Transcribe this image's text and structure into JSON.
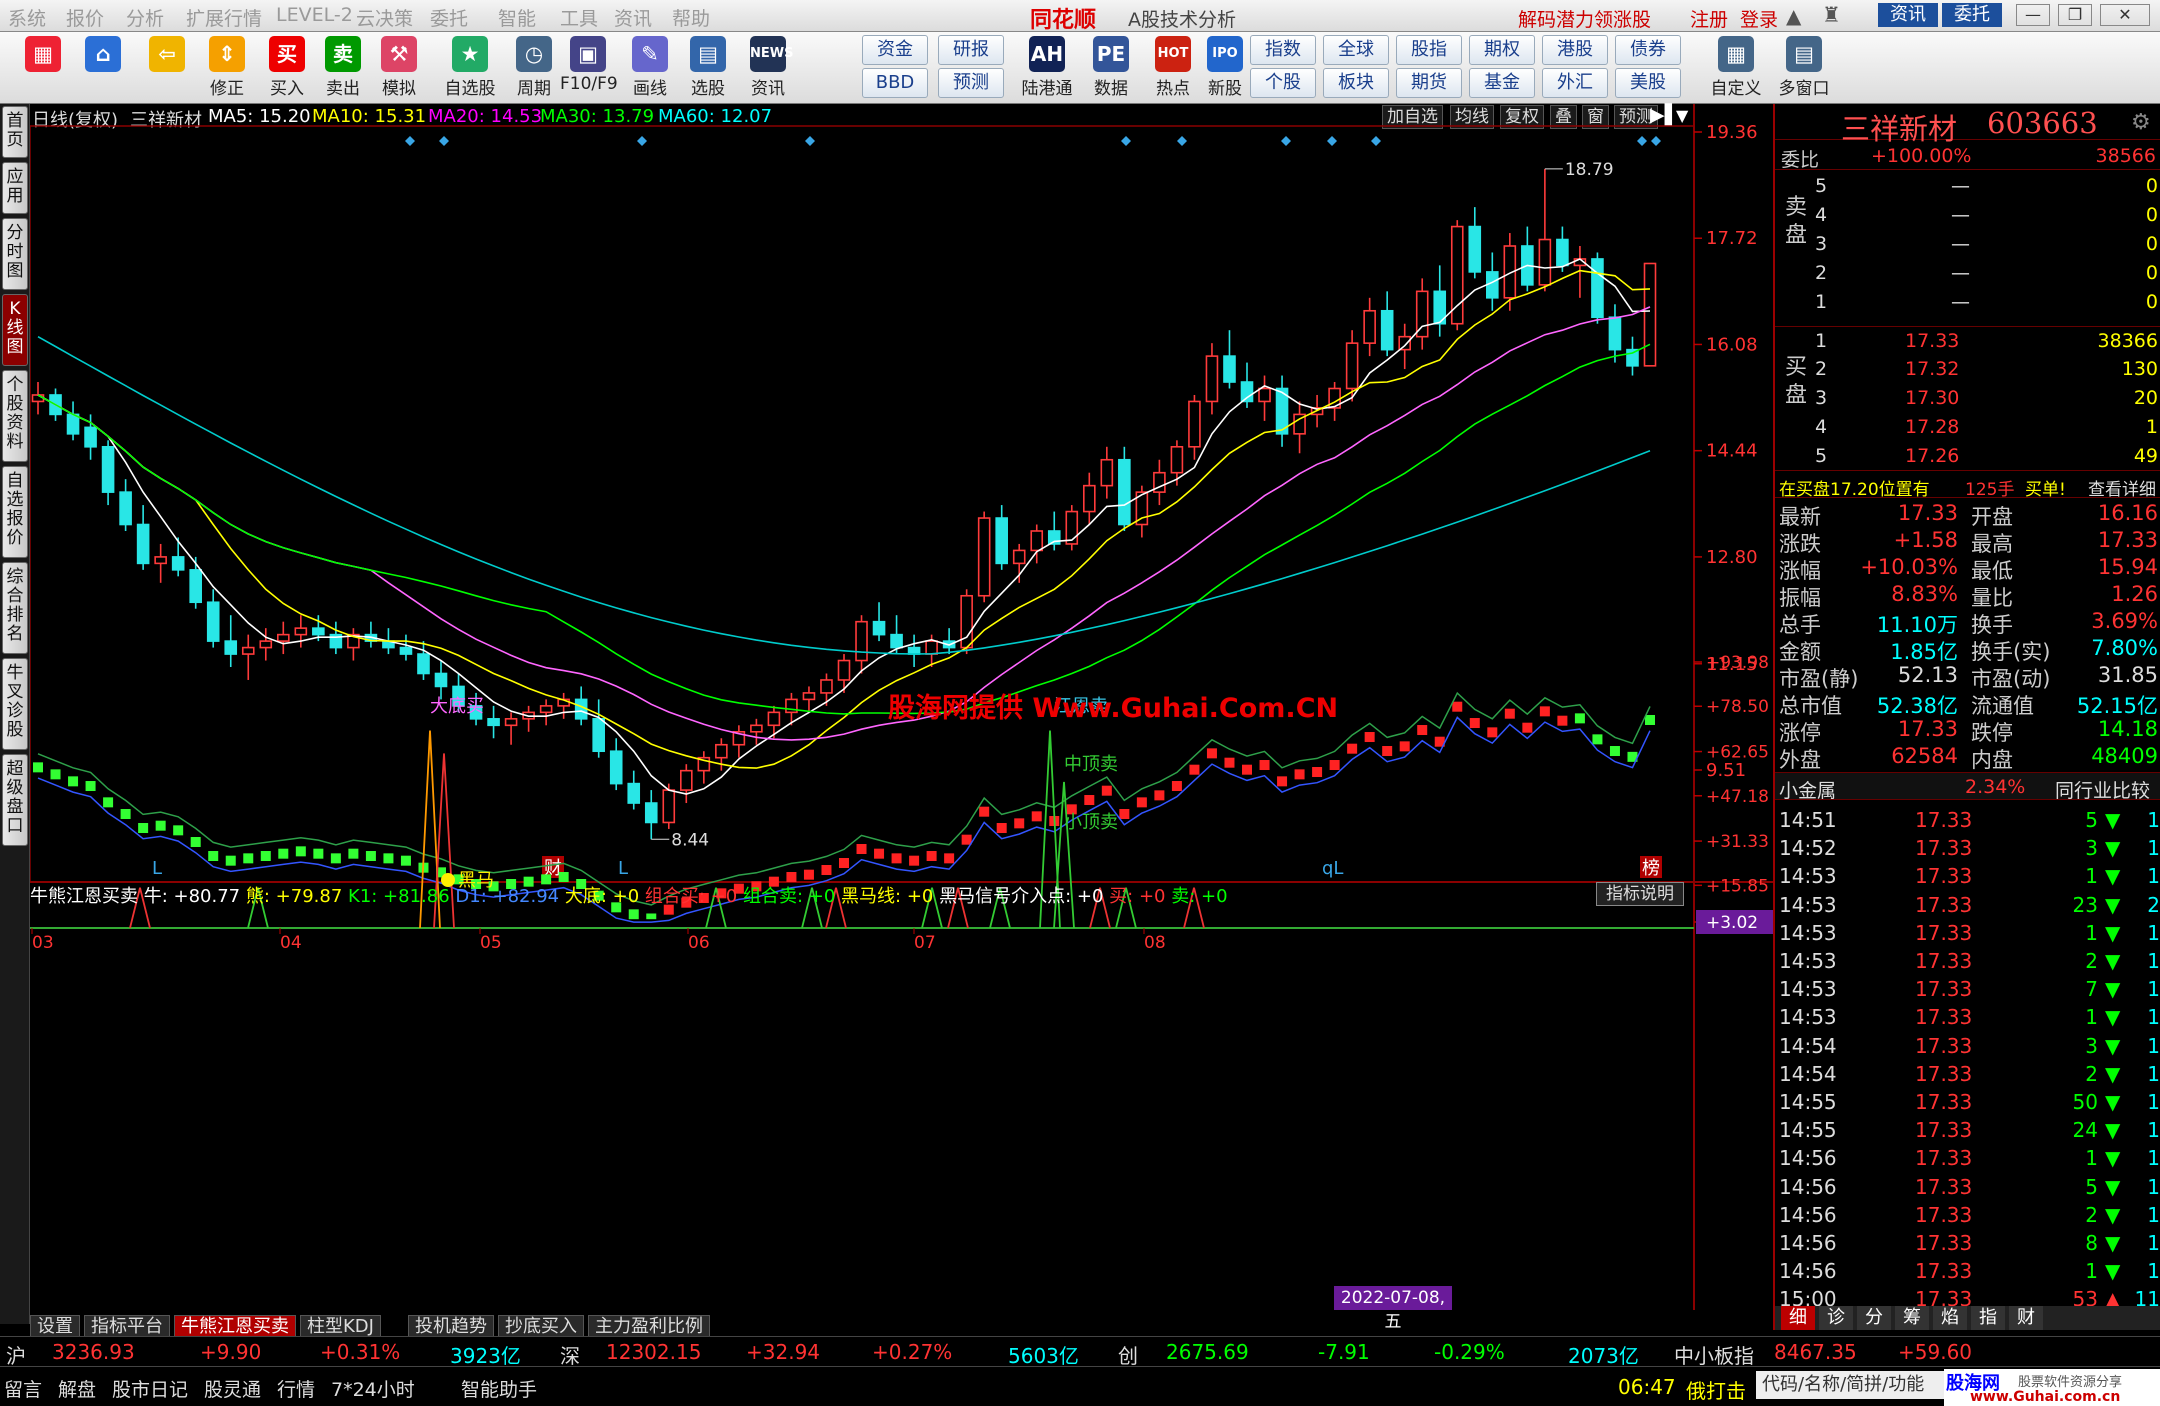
{
  "menu": [
    "系统",
    "报价",
    "分析",
    "扩展行情",
    "LEVEL-2",
    "云决策",
    "委托",
    "智能",
    "工具",
    "资讯",
    "帮助"
  ],
  "app_logo": "同花顺",
  "app_title": "A股技术分析",
  "menu_right": {
    "promo": "解码潜力领涨股",
    "register": "注册",
    "login": "登录",
    "news": "资讯",
    "trade": "委托"
  },
  "toolbar": [
    {
      "label": "",
      "icon": "grid-icon",
      "color": "#e23"
    },
    {
      "label": "",
      "icon": "home-icon",
      "color": "#2b6fd6"
    },
    {
      "label": "",
      "icon": "back-arrow-icon",
      "color": "#f0b400"
    },
    {
      "label": "修正",
      "icon": "updown-icon",
      "color": "#f5a000"
    },
    {
      "label": "买入",
      "icon": "buy-icon",
      "color": "#e00",
      "ch": "买"
    },
    {
      "label": "卖出",
      "icon": "sell-icon",
      "color": "#090",
      "ch": "卖"
    },
    {
      "label": "模拟",
      "icon": "hammer-icon",
      "color": "#d46"
    },
    {
      "label": "自选股",
      "icon": "star-icon",
      "color": "#2a6"
    },
    {
      "label": "周期",
      "icon": "clock-icon",
      "color": "#468"
    },
    {
      "label": "F10/F9",
      "icon": "f10-icon",
      "color": "#448"
    },
    {
      "label": "画线",
      "icon": "pen-icon",
      "color": "#66c"
    },
    {
      "label": "选股",
      "icon": "select-icon",
      "color": "#36a"
    },
    {
      "label": "资讯",
      "icon": "news-icon",
      "color": "#235",
      "ch": "NEWS"
    }
  ],
  "toolbar_blocks": [
    {
      "top": "资金",
      "bottom": "BBD"
    },
    {
      "top": "研报",
      "bottom": "预测"
    }
  ],
  "toolbar2": [
    {
      "label": "陆港通",
      "ch": "AH",
      "color": "#125"
    },
    {
      "label": "数据",
      "ch": "PE",
      "color": "#359"
    },
    {
      "label": "热点",
      "ch": "HOT",
      "color": "#c21"
    },
    {
      "label": "新股",
      "ch": "IPO",
      "color": "#26c"
    }
  ],
  "toolbar_grid": [
    [
      "指数",
      "全球",
      "股指",
      "期权",
      "港股",
      "债券"
    ],
    [
      "个股",
      "板块",
      "期货",
      "基金",
      "外汇",
      "美股"
    ]
  ],
  "toolbar_end": [
    {
      "label": "自定义"
    },
    {
      "label": "多窗口"
    }
  ],
  "left_tabs": [
    "首页",
    "应用",
    "分时图",
    "K线图",
    "个股资料",
    "自选报价",
    "综合排名",
    "牛叉诊股",
    "超级盘口"
  ],
  "main_header": {
    "period": "日线(复权)",
    "name": "三祥新材",
    "ma5": "MA5: 15.20",
    "ma10": "MA10: 15.31",
    "ma20": "MA20: 14.53",
    "ma30": "MA30: 13.79",
    "ma60": "MA60: 12.07"
  },
  "main_tools": [
    "加自选",
    "均线",
    "复权",
    "叠",
    "窗",
    "预测"
  ],
  "watermark": "股海网提供 Www.Guhai.Com.CN",
  "price_axis": [
    "19.36",
    "17.72",
    "16.08",
    "14.44",
    "12.80",
    "11.15",
    "9.51"
  ],
  "price_high_label": "18.79",
  "price_low_label": "8.44",
  "main_bottom_marks": [
    "L",
    "财",
    "L",
    "qL",
    "榜"
  ],
  "ind_header": {
    "name": "牛熊江恩买卖",
    "niu": "牛: +80.77",
    "xiong": "熊: +79.87",
    "k1": "K1: +81.86",
    "d1": "D1: +82.94",
    "dadi": "大底: +0",
    "zhmai": "组合买: +0",
    "zhmaichu": "组合卖: +0",
    "heima": "黑马线: +0",
    "heima2": "黑马信号介入点: +0",
    "mai": "买: +0",
    "maichu": "卖: +0",
    "explain": "指标说明"
  },
  "ind_axis": [
    "+93.98",
    "+78.50",
    "+62.65",
    "+47.18",
    "+31.33",
    "+15.85",
    "+3.02"
  ],
  "ind_labels": {
    "dadi": "大底买",
    "heima": "黑马",
    "jiangen": "江恩卖",
    "zhong": "中顶卖",
    "xiao": "小顶卖"
  },
  "x_axis": [
    "03",
    "04",
    "05",
    "06",
    "07",
    "08"
  ],
  "date_badge": "2022-07-08,五",
  "bottom_tabs": [
    "设置",
    "指标平台",
    "牛熊江恩买卖",
    "柱型KDJ",
    "投机趋势",
    "抄底买入",
    "主力盈利比例"
  ],
  "stock": {
    "name": "三祥新材",
    "code": "603663"
  },
  "weibi": {
    "label": "委比",
    "pct": "+100.00%",
    "val": "38566"
  },
  "sell": [
    {
      "n": "5",
      "p": "—",
      "v": "0"
    },
    {
      "n": "4",
      "p": "—",
      "v": "0"
    },
    {
      "n": "3",
      "p": "—",
      "v": "0"
    },
    {
      "n": "2",
      "p": "—",
      "v": "0"
    },
    {
      "n": "1",
      "p": "—",
      "v": "0"
    }
  ],
  "buy": [
    {
      "n": "1",
      "p": "17.33",
      "v": "38366"
    },
    {
      "n": "2",
      "p": "17.32",
      "v": "130"
    },
    {
      "n": "3",
      "p": "17.30",
      "v": "20"
    },
    {
      "n": "4",
      "p": "17.28",
      "v": "1"
    },
    {
      "n": "5",
      "p": "17.26",
      "v": "49"
    }
  ],
  "sell_label": "卖盘",
  "buy_label": "买盘",
  "notice": {
    "t1": "在买盘17.20位置有",
    "t2": "125手",
    "t3": "买单!",
    "t4": "查看详细"
  },
  "quote": [
    [
      "最新",
      "17.33",
      "开盘",
      "16.16"
    ],
    [
      "涨跌",
      "+1.58",
      "最高",
      "17.33"
    ],
    [
      "涨幅",
      "+10.03%",
      "最低",
      "15.94"
    ],
    [
      "振幅",
      "8.83%",
      "量比",
      "1.26"
    ],
    [
      "总手",
      "11.10万",
      "换手",
      "3.69%"
    ],
    [
      "金额",
      "1.85亿",
      "换手(实)",
      "7.80%"
    ],
    [
      "市盈(静)",
      "52.13",
      "市盈(动)",
      "31.85"
    ],
    [
      "总市值",
      "52.38亿",
      "流通值",
      "52.15亿"
    ],
    [
      "涨停",
      "17.33",
      "跌停",
      "14.18"
    ],
    [
      "外盘",
      "62584",
      "内盘",
      "48409"
    ]
  ],
  "sector": {
    "name": "小金属",
    "pct": "2.34%",
    "btn": "同行业比较"
  },
  "ticks": [
    [
      "14:51",
      "17.33",
      "5"
    ],
    [
      "14:52",
      "17.33",
      "3"
    ],
    [
      "14:53",
      "17.33",
      "1"
    ],
    [
      "14:53",
      "17.33",
      "23"
    ],
    [
      "14:53",
      "17.33",
      "1"
    ],
    [
      "14:53",
      "17.33",
      "2"
    ],
    [
      "14:53",
      "17.33",
      "7"
    ],
    [
      "14:53",
      "17.33",
      "1"
    ],
    [
      "14:54",
      "17.33",
      "3"
    ],
    [
      "14:54",
      "17.33",
      "2"
    ],
    [
      "14:55",
      "17.33",
      "50"
    ],
    [
      "14:55",
      "17.33",
      "24"
    ],
    [
      "14:56",
      "17.33",
      "1"
    ],
    [
      "14:56",
      "17.33",
      "5"
    ],
    [
      "14:56",
      "17.33",
      "2"
    ],
    [
      "14:56",
      "17.33",
      "8"
    ],
    [
      "14:56",
      "17.33",
      "1"
    ],
    [
      "15:00",
      "17.33",
      "53"
    ]
  ],
  "tick_extra": [
    "1",
    "1",
    "1",
    "2",
    "1",
    "1",
    "1",
    "1",
    "1",
    "1",
    "1",
    "1",
    "1",
    "1",
    "1",
    "1",
    "1",
    "11"
  ],
  "rp_tabs": [
    "细",
    "诊",
    "分",
    "筹",
    "焰",
    "指",
    "财"
  ],
  "index_bar": {
    "sh": "沪",
    "sh_val": "3236.93",
    "sh_chg": "+9.90",
    "sh_pct": "+0.31%",
    "sh_amt": "3923亿",
    "sz": "深",
    "sz_val": "12302.15",
    "sz_chg": "+32.94",
    "sz_pct": "+0.27%",
    "sz_amt": "5603亿",
    "cy": "创",
    "cy_val": "2675.69",
    "cy_chg": "-7.91",
    "cy_pct": "-0.29%",
    "cy_amt": "2073亿",
    "zx": "中小板指",
    "zx_val": "8467.35",
    "zx_chg": "+59.60"
  },
  "status_bar": [
    "留言",
    "解盘",
    "股市日记",
    "股灵通",
    "行情",
    "7*24小时",
    "智能助手"
  ],
  "status_time": "06:47",
  "status_msg": "俄打击",
  "search": "代码/名称/简拼/功能",
  "site": "股海网",
  "site_sub": "股票软件资源分享",
  "site_url": "www.Guhai.com.cn",
  "chart_data": {
    "type": "candlestick",
    "ylim": [
      8.44,
      19.36
    ],
    "x": [
      "03",
      "04",
      "05",
      "06",
      "07",
      "08"
    ],
    "high": 18.79,
    "low": 8.44,
    "ohlc": [
      [
        15.2,
        15.5,
        15.0,
        15.3
      ],
      [
        15.3,
        15.4,
        14.9,
        15.0
      ],
      [
        15.0,
        15.2,
        14.6,
        14.7
      ],
      [
        14.8,
        15.0,
        14.3,
        14.5
      ],
      [
        14.5,
        14.6,
        13.6,
        13.8
      ],
      [
        13.8,
        14.0,
        13.2,
        13.3
      ],
      [
        13.3,
        13.6,
        12.6,
        12.7
      ],
      [
        12.7,
        13.0,
        12.4,
        12.8
      ],
      [
        12.8,
        13.1,
        12.5,
        12.6
      ],
      [
        12.6,
        12.8,
        12.0,
        12.1
      ],
      [
        12.1,
        12.3,
        11.4,
        11.5
      ],
      [
        11.5,
        11.9,
        11.1,
        11.3
      ],
      [
        11.3,
        11.6,
        10.9,
        11.4
      ],
      [
        11.4,
        11.7,
        11.2,
        11.5
      ],
      [
        11.5,
        11.8,
        11.3,
        11.6
      ],
      [
        11.6,
        11.9,
        11.4,
        11.7
      ],
      [
        11.7,
        11.9,
        11.5,
        11.6
      ],
      [
        11.6,
        11.8,
        11.3,
        11.4
      ],
      [
        11.4,
        11.7,
        11.2,
        11.6
      ],
      [
        11.6,
        11.8,
        11.4,
        11.5
      ],
      [
        11.5,
        11.7,
        11.3,
        11.4
      ],
      [
        11.4,
        11.6,
        11.2,
        11.3
      ],
      [
        11.3,
        11.5,
        10.9,
        11.0
      ],
      [
        11.0,
        11.2,
        10.6,
        10.8
      ],
      [
        10.8,
        11.0,
        10.4,
        10.5
      ],
      [
        10.5,
        10.7,
        10.2,
        10.3
      ],
      [
        10.3,
        10.5,
        10.0,
        10.2
      ],
      [
        10.2,
        10.4,
        9.9,
        10.3
      ],
      [
        10.3,
        10.5,
        10.1,
        10.4
      ],
      [
        10.4,
        10.6,
        10.2,
        10.5
      ],
      [
        10.5,
        10.7,
        10.3,
        10.6
      ],
      [
        10.6,
        10.8,
        10.2,
        10.3
      ],
      [
        10.3,
        10.6,
        9.7,
        9.8
      ],
      [
        9.8,
        10.0,
        9.2,
        9.3
      ],
      [
        9.3,
        9.5,
        8.9,
        9.0
      ],
      [
        9.0,
        9.2,
        8.44,
        8.7
      ],
      [
        8.7,
        9.3,
        8.6,
        9.2
      ],
      [
        9.2,
        9.6,
        9.0,
        9.5
      ],
      [
        9.5,
        9.8,
        9.3,
        9.7
      ],
      [
        9.7,
        10.0,
        9.5,
        9.9
      ],
      [
        9.9,
        10.2,
        9.7,
        10.1
      ],
      [
        10.1,
        10.3,
        9.9,
        10.2
      ],
      [
        10.2,
        10.5,
        10.0,
        10.4
      ],
      [
        10.4,
        10.7,
        10.2,
        10.6
      ],
      [
        10.6,
        10.8,
        10.4,
        10.7
      ],
      [
        10.7,
        11.0,
        10.5,
        10.9
      ],
      [
        10.9,
        11.3,
        10.7,
        11.2
      ],
      [
        11.2,
        11.9,
        11.0,
        11.8
      ],
      [
        11.8,
        12.1,
        11.5,
        11.6
      ],
      [
        11.6,
        11.9,
        11.3,
        11.4
      ],
      [
        11.4,
        11.6,
        11.1,
        11.3
      ],
      [
        11.3,
        11.6,
        11.1,
        11.5
      ],
      [
        11.5,
        11.7,
        11.3,
        11.4
      ],
      [
        11.4,
        12.3,
        11.3,
        12.2
      ],
      [
        12.2,
        13.5,
        12.1,
        13.4
      ],
      [
        13.4,
        13.6,
        12.6,
        12.7
      ],
      [
        12.7,
        13.0,
        12.4,
        12.9
      ],
      [
        12.9,
        13.3,
        12.7,
        13.2
      ],
      [
        13.2,
        13.5,
        12.9,
        13.0
      ],
      [
        13.0,
        13.6,
        12.9,
        13.5
      ],
      [
        13.5,
        14.1,
        13.3,
        13.9
      ],
      [
        13.9,
        14.5,
        13.7,
        14.3
      ],
      [
        14.3,
        14.5,
        13.2,
        13.3
      ],
      [
        13.3,
        13.9,
        13.1,
        13.8
      ],
      [
        13.8,
        14.3,
        13.6,
        14.1
      ],
      [
        14.1,
        14.6,
        13.9,
        14.5
      ],
      [
        14.5,
        15.3,
        14.3,
        15.2
      ],
      [
        15.2,
        16.1,
        15.0,
        15.9
      ],
      [
        15.9,
        16.3,
        15.4,
        15.5
      ],
      [
        15.5,
        15.8,
        15.1,
        15.2
      ],
      [
        15.2,
        15.6,
        14.9,
        15.4
      ],
      [
        15.4,
        15.6,
        14.5,
        14.7
      ],
      [
        14.7,
        15.2,
        14.4,
        15.0
      ],
      [
        15.0,
        15.3,
        14.8,
        15.1
      ],
      [
        15.1,
        15.5,
        14.9,
        15.4
      ],
      [
        15.4,
        16.3,
        15.2,
        16.1
      ],
      [
        16.1,
        16.8,
        15.9,
        16.6
      ],
      [
        16.6,
        16.9,
        15.9,
        16.0
      ],
      [
        16.0,
        16.4,
        15.7,
        16.2
      ],
      [
        16.2,
        17.1,
        16.0,
        16.9
      ],
      [
        16.9,
        17.3,
        16.2,
        16.4
      ],
      [
        16.4,
        18.0,
        16.3,
        17.9
      ],
      [
        17.9,
        18.2,
        17.1,
        17.2
      ],
      [
        17.2,
        17.5,
        16.6,
        16.8
      ],
      [
        16.8,
        17.8,
        16.6,
        17.6
      ],
      [
        17.6,
        17.9,
        16.9,
        17.0
      ],
      [
        17.0,
        18.79,
        16.9,
        17.7
      ],
      [
        17.7,
        17.9,
        17.2,
        17.3
      ],
      [
        17.3,
        17.6,
        16.8,
        17.4
      ],
      [
        17.4,
        17.5,
        16.4,
        16.5
      ],
      [
        16.5,
        16.7,
        15.8,
        16.0
      ],
      [
        16.0,
        16.2,
        15.6,
        15.75
      ],
      [
        15.75,
        17.33,
        15.94,
        17.33
      ]
    ]
  }
}
